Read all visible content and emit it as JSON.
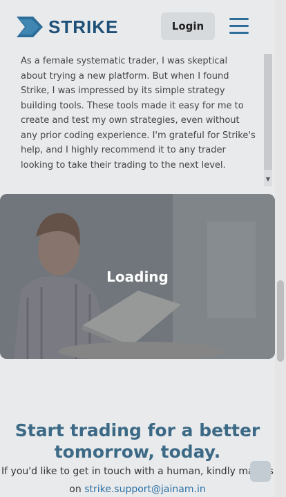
{
  "header": {
    "logo_text": "STRIKE",
    "login_label": "Login"
  },
  "testimonial": {
    "text": "As a female systematic trader, I was skeptical about trying a new platform. But when I found Strike, I was impressed by its simple strategy building tools. These tools made it easy for me to create and test my own strategies, even without any prior coding experience. I'm grateful for Strike's help, and I highly recommend it to any trader looking to take their trading to the next level."
  },
  "video": {
    "loading_label": "Loading"
  },
  "cta": {
    "title": "Start trading for a better tomorrow, today.",
    "body_prefix": "If you'd like to get in touch with a human, kindly mail us on",
    "email": "strike.support@jainam.in"
  },
  "icons": {
    "menu": "hamburger-icon",
    "logo": "strike-chevron-icon",
    "scroll_arrow": "chevron-down-icon"
  },
  "colors": {
    "brand": "#1d4f78",
    "accent": "#2c6d99",
    "cta_title": "#3c6a86",
    "email_link": "#2a6fa3"
  }
}
